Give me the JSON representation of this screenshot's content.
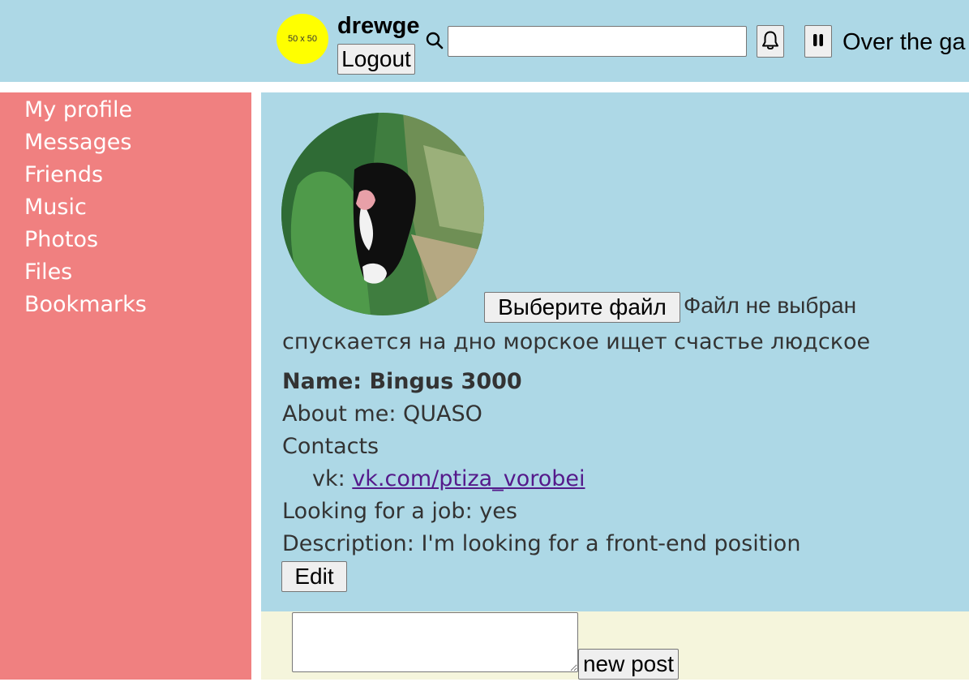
{
  "header": {
    "avatar_placeholder": "50 x 50",
    "username": "drewge",
    "logout_label": "Logout",
    "search_value": "",
    "now_playing": "Over the ga"
  },
  "sidebar": {
    "items": [
      {
        "label": "My profile"
      },
      {
        "label": "Messages"
      },
      {
        "label": "Friends"
      },
      {
        "label": "Music"
      },
      {
        "label": "Photos"
      },
      {
        "label": "Files"
      },
      {
        "label": "Bookmarks"
      }
    ]
  },
  "profile": {
    "choose_file_label": "Выберите файл",
    "file_status": "Файл не выбран",
    "status": "спускается на дно морское ищет счастье людское",
    "name": "Name: Bingus 3000",
    "about": "About me: QUASO",
    "contacts_label": "Contacts",
    "vk_label": "vk:",
    "vk_link": "vk.com/ptiza_vorobei",
    "looking_for_job": "Looking for a job: yes",
    "description": "Description: I'm looking for a front-end position",
    "edit_label": "Edit"
  },
  "posts": {
    "textarea_value": "",
    "new_post_label": "new post"
  },
  "colors": {
    "header_bg": "#add8e6",
    "sidebar_bg": "#f08080",
    "profile_bg": "#add8e6",
    "posts_bg": "#f5f5dc",
    "avatar_bg": "#ffff00",
    "link": "#551a8b"
  },
  "icons": {
    "search": "search-icon",
    "bell": "bell-icon",
    "pause": "pause-icon"
  }
}
